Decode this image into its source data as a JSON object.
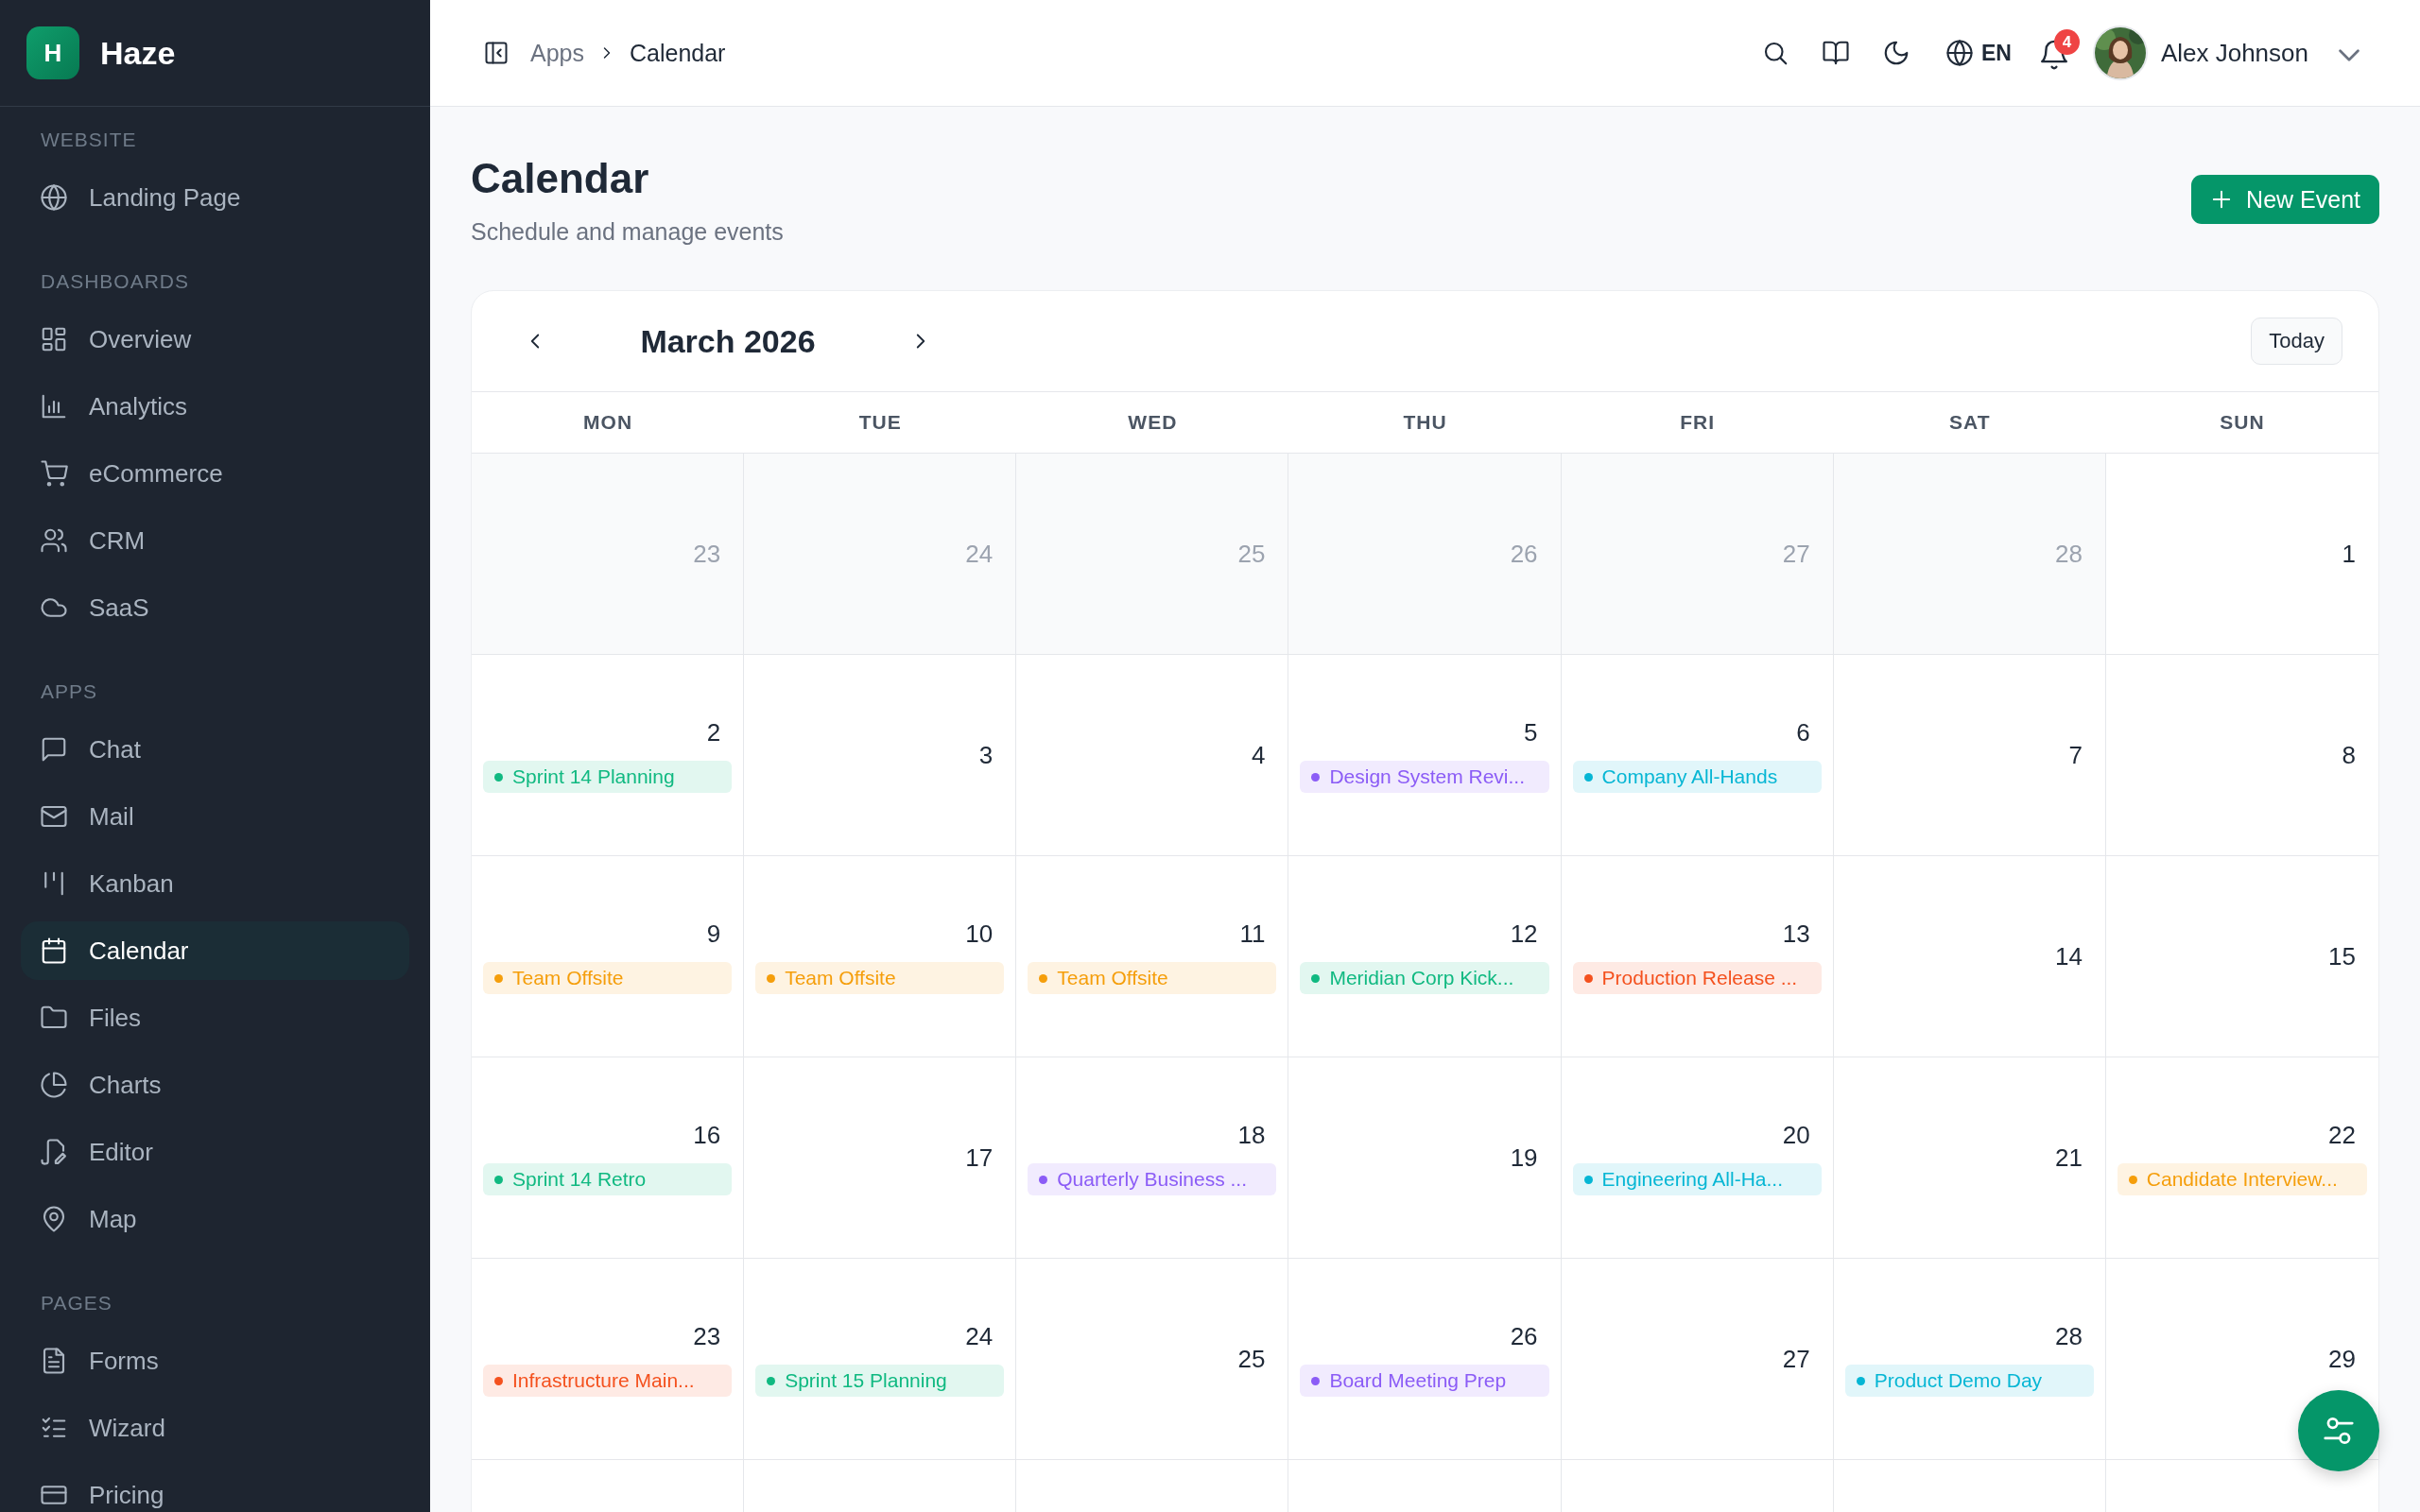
{
  "sidebar": {
    "brand": {
      "logo": "H",
      "name": "Haze"
    },
    "sections": [
      {
        "title": "WEBSITE",
        "items": [
          {
            "label": "Landing Page",
            "selected": false
          }
        ]
      },
      {
        "title": "DASHBOARDS",
        "items": [
          {
            "label": "Overview",
            "selected": false
          },
          {
            "label": "Analytics",
            "selected": false
          },
          {
            "label": "eCommerce",
            "selected": false
          },
          {
            "label": "CRM",
            "selected": false
          },
          {
            "label": "SaaS",
            "selected": false
          }
        ]
      },
      {
        "title": "APPS",
        "items": [
          {
            "label": "Chat",
            "selected": false
          },
          {
            "label": "Mail",
            "selected": false
          },
          {
            "label": "Kanban",
            "selected": false
          },
          {
            "label": "Calendar",
            "selected": true
          },
          {
            "label": "Files",
            "selected": false
          },
          {
            "label": "Charts",
            "selected": false
          },
          {
            "label": "Editor",
            "selected": false
          },
          {
            "label": "Map",
            "selected": false
          }
        ]
      },
      {
        "title": "PAGES",
        "items": [
          {
            "label": "Forms",
            "selected": false
          },
          {
            "label": "Wizard",
            "selected": false
          },
          {
            "label": "Pricing",
            "selected": false
          }
        ]
      }
    ]
  },
  "header": {
    "breadcrumb": [
      "Apps",
      "Calendar"
    ],
    "language": "EN",
    "notifications": "4",
    "user": {
      "name": "Alex Johnson"
    }
  },
  "page": {
    "title": "Calendar",
    "subtitle": "Schedule and manage events",
    "new_event_button": "New Event"
  },
  "calendar": {
    "month": "March 2026",
    "today_button": "Today",
    "weekdays": [
      "MON",
      "TUE",
      "WED",
      "THU",
      "FRI",
      "SAT",
      "SUN"
    ],
    "weeks": [
      [
        {
          "day": "23",
          "outside": true
        },
        {
          "day": "24",
          "outside": true
        },
        {
          "day": "25",
          "outside": true
        },
        {
          "day": "26",
          "outside": true
        },
        {
          "day": "27",
          "outside": true
        },
        {
          "day": "28",
          "outside": true
        },
        {
          "day": "1",
          "outside": false
        }
      ],
      [
        {
          "day": "2",
          "outside": false,
          "events": [
            {
              "title": "Sprint 14 Planning",
              "color": "#10b981"
            }
          ]
        },
        {
          "day": "3",
          "outside": false
        },
        {
          "day": "4",
          "outside": false
        },
        {
          "day": "5",
          "outside": false,
          "events": [
            {
              "title": "Design System Revi...",
              "color": "#8b5cf6"
            }
          ]
        },
        {
          "day": "6",
          "outside": false,
          "events": [
            {
              "title": "Company All-Hands",
              "color": "#06b6d4"
            }
          ]
        },
        {
          "day": "7",
          "outside": false
        },
        {
          "day": "8",
          "outside": false
        }
      ],
      [
        {
          "day": "9",
          "outside": false,
          "events": [
            {
              "title": "Team Offsite",
              "color": "#f59e0b"
            }
          ]
        },
        {
          "day": "10",
          "outside": false,
          "events": [
            {
              "title": "Team Offsite",
              "color": "#f59e0b"
            }
          ]
        },
        {
          "day": "11",
          "outside": false,
          "events": [
            {
              "title": "Team Offsite",
              "color": "#f59e0b"
            }
          ]
        },
        {
          "day": "12",
          "outside": false,
          "events": [
            {
              "title": "Meridian Corp Kick...",
              "color": "#10b981"
            }
          ]
        },
        {
          "day": "13",
          "outside": false,
          "events": [
            {
              "title": "Production Release ...",
              "color": "#f4511e"
            }
          ]
        },
        {
          "day": "14",
          "outside": false
        },
        {
          "day": "15",
          "outside": false
        }
      ],
      [
        {
          "day": "16",
          "outside": false,
          "events": [
            {
              "title": "Sprint 14 Retro",
              "color": "#10b981"
            }
          ]
        },
        {
          "day": "17",
          "outside": false
        },
        {
          "day": "18",
          "outside": false,
          "events": [
            {
              "title": "Quarterly Business ...",
              "color": "#8b5cf6"
            }
          ]
        },
        {
          "day": "19",
          "outside": false
        },
        {
          "day": "20",
          "outside": false,
          "events": [
            {
              "title": "Engineering All-Ha...",
              "color": "#06b6d4"
            }
          ]
        },
        {
          "day": "21",
          "outside": false
        },
        {
          "day": "22",
          "outside": false,
          "events": [
            {
              "title": "Candidate Interview...",
              "color": "#f59e0b"
            }
          ]
        }
      ],
      [
        {
          "day": "23",
          "outside": false,
          "events": [
            {
              "title": "Infrastructure Main...",
              "color": "#f4511e"
            }
          ]
        },
        {
          "day": "24",
          "outside": false,
          "events": [
            {
              "title": "Sprint 15 Planning",
              "color": "#10b981"
            }
          ]
        },
        {
          "day": "25",
          "outside": false
        },
        {
          "day": "26",
          "outside": false,
          "events": [
            {
              "title": "Board Meeting Prep",
              "color": "#8b5cf6"
            }
          ]
        },
        {
          "day": "27",
          "outside": false
        },
        {
          "day": "28",
          "outside": false,
          "events": [
            {
              "title": "Product Demo Day",
              "color": "#06b6d4"
            }
          ]
        },
        {
          "day": "29",
          "outside": false
        }
      ]
    ]
  }
}
